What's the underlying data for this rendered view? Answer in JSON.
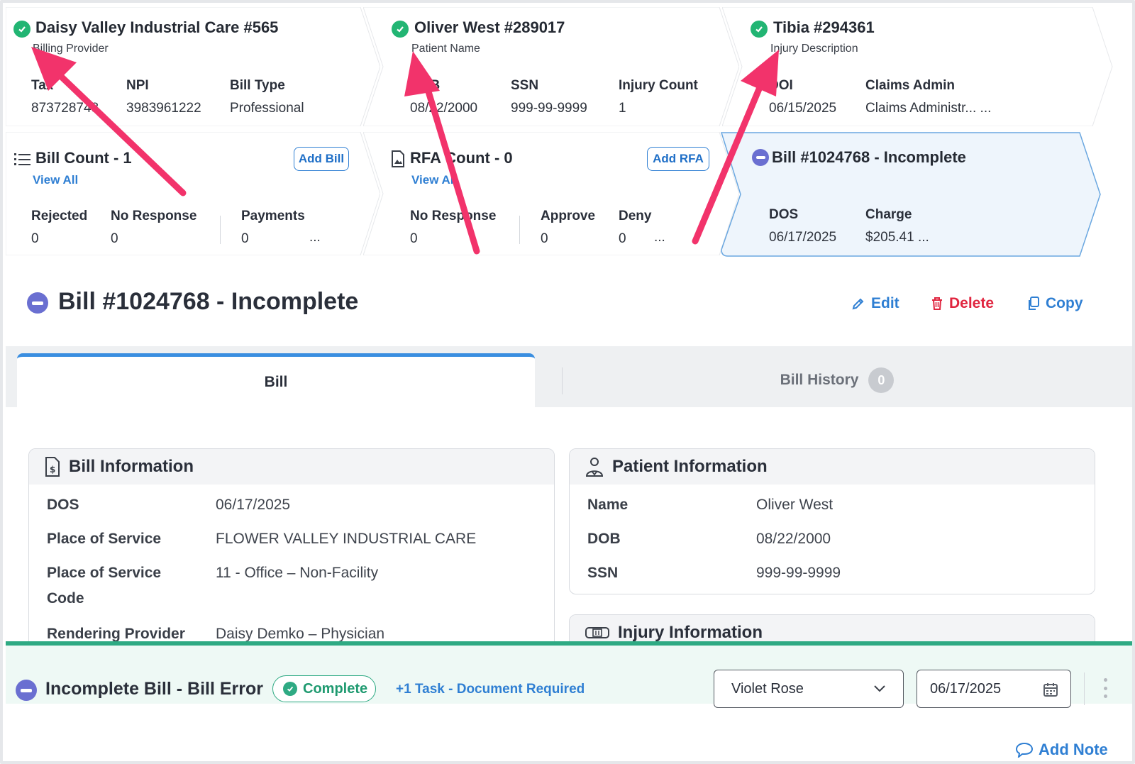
{
  "summary": {
    "provider": {
      "title": "Daisy Valley Industrial Care #565",
      "subtitle": "Billing Provider",
      "fields": [
        {
          "label": "Tax",
          "value": "873728748"
        },
        {
          "label": "NPI",
          "value": "3983961222"
        },
        {
          "label": "Bill Type",
          "value": "Professional"
        }
      ]
    },
    "patient": {
      "title": "Oliver West #289017",
      "subtitle": "Patient Name",
      "fields": [
        {
          "label": "DOB",
          "value": "08/22/2000"
        },
        {
          "label": "SSN",
          "value": "999-99-9999"
        },
        {
          "label": "Injury Count",
          "value": "1"
        }
      ]
    },
    "injury": {
      "title": "Tibia #294361",
      "subtitle": "Injury Description",
      "fields": [
        {
          "label": "DOI",
          "value": "06/15/2025"
        },
        {
          "label": "Claims Admin",
          "value": "Claims Administr... ..."
        }
      ]
    }
  },
  "bills_card": {
    "title": "Bill Count - 1",
    "view_all": "View All",
    "add_button": "Add Bill",
    "stats": [
      {
        "label": "Rejected",
        "value": "0"
      },
      {
        "label": "No Response",
        "value": "0"
      },
      {
        "label": "Payments",
        "value": "0"
      }
    ],
    "more": "..."
  },
  "rfa_card": {
    "title": "RFA Count - 0",
    "view_all": "View All",
    "add_button": "Add RFA",
    "stats": [
      {
        "label": "No Response",
        "value": "0"
      },
      {
        "label": "Approve",
        "value": "0"
      },
      {
        "label": "Deny",
        "value": "0"
      }
    ],
    "more": "..."
  },
  "current_bill_card": {
    "title": "Bill #1024768 - Incomplete",
    "stats": [
      {
        "label": "DOS",
        "value": "06/17/2025"
      },
      {
        "label": "Charge",
        "value": "$205.41 ..."
      }
    ]
  },
  "header": {
    "title": "Bill #1024768 - Incomplete",
    "edit": "Edit",
    "delete": "Delete",
    "copy": "Copy"
  },
  "tabs": {
    "bill": "Bill",
    "history": "Bill History",
    "history_count": "0"
  },
  "bill_info": {
    "heading": "Bill Information",
    "rows": [
      {
        "label": "DOS",
        "value": "06/17/2025"
      },
      {
        "label": "Place of Service",
        "value": "FLOWER VALLEY INDUSTRIAL CARE"
      },
      {
        "label": "Place of Service Code",
        "value": "11 - Office – Non-Facility"
      },
      {
        "label": "Rendering Provider",
        "value": "Daisy Demko – Physician"
      }
    ]
  },
  "patient_info": {
    "heading": "Patient Information",
    "rows": [
      {
        "label": "Name",
        "value": "Oliver West"
      },
      {
        "label": "DOB",
        "value": "08/22/2000"
      },
      {
        "label": "SSN",
        "value": "999-99-9999"
      }
    ]
  },
  "injury_info": {
    "heading": "Injury Information"
  },
  "task_bar": {
    "title": "Incomplete Bill - Bill Error",
    "status": "Complete",
    "task_link": "+1 Task - Document Required",
    "assignee": "Violet Rose",
    "date": "06/17/2025"
  },
  "footer": {
    "add_note": "Add Note"
  },
  "colors": {
    "accent": "#2f7fd3",
    "success": "#22b573",
    "danger": "#e0253f",
    "incomplete": "#6a6fd1",
    "annotation_arrow": "#f2336b"
  }
}
